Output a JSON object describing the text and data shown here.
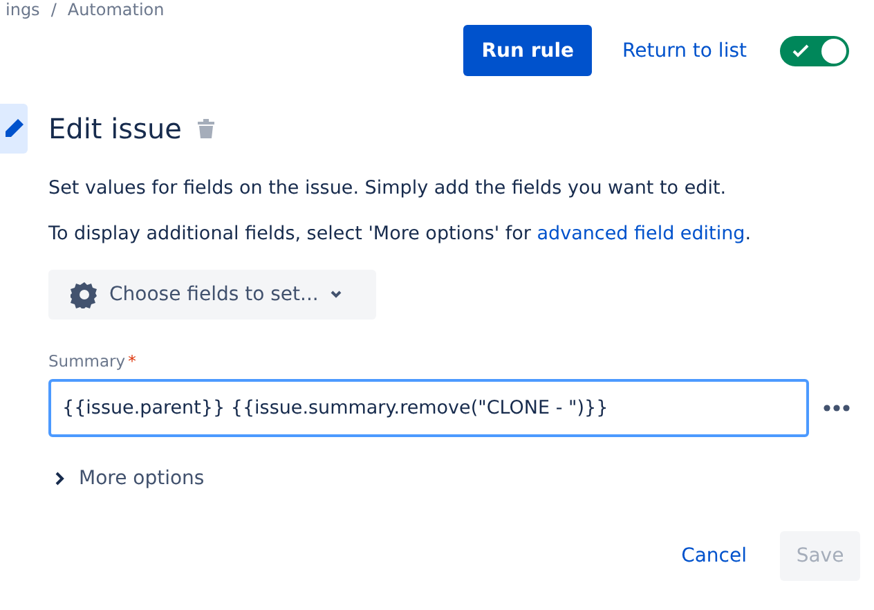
{
  "breadcrumb": [
    "ings",
    "/",
    "Automation"
  ],
  "toolbar": {
    "run_button": "Run rule",
    "return_link": "Return to list",
    "rule_enabled": {
      "on": true
    }
  },
  "action": {
    "title": "Edit issue",
    "description": "Set values for fields on the issue. Simply add the fields you want to edit.",
    "hint": {
      "text": "To display additional fields, select 'More options' for ",
      "link": "advanced field editing",
      "after": "."
    },
    "choose_button": "Choose fields to set...",
    "field": {
      "label": "Summary",
      "required_mark": "*",
      "value": "{{issue.parent}} {{issue.summary.remove(\"CLONE - \")}}",
      "focused": true
    },
    "more_options": {
      "label": "More options",
      "expanded": false
    }
  },
  "footer": {
    "cancel": "Cancel",
    "save": {
      "label": "Save",
      "disabled": true
    }
  }
}
